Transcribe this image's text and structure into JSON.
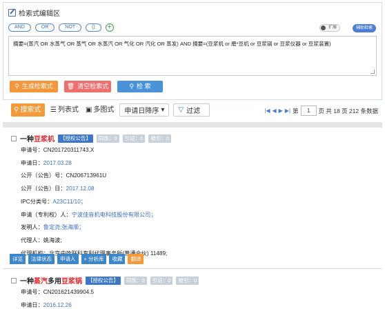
{
  "editor": {
    "title": "检索式编辑区",
    "ops": [
      "AND",
      "OR",
      "NOT",
      "()"
    ],
    "toggle_label": "扩展",
    "help_label": "辅助检索",
    "query": "摘要=(蒸汽 OR 水蒸气 OR 蒸气 OR 水蒸汽 OR 气化 OR 汽化 OR 蒸发) AND 摘要=(豆浆机 or 磨*豆机 or 豆浆锅 or 豆浆仪器 or 豆浆装置)",
    "btn_generate": "生成检索式",
    "btn_clear": "清空检索式",
    "btn_search": "检 索"
  },
  "toolbar": {
    "tab_search": "搜索式",
    "tab_list": "列表式",
    "tab_multi": "多图式",
    "sort": "申请日降序",
    "filter": "过滤"
  },
  "pager": {
    "prefix": "第",
    "page": "1",
    "suffix": "页 共 18 页 212 条数据"
  },
  "records": [
    {
      "title_pre": "一种",
      "title_hl": "豆浆机",
      "title_mid": "",
      "title_hl2": "",
      "tag": "【授权公告】",
      "same_family": "同族：0",
      "cited": "引证：0",
      "cited_by": "被引：0",
      "app_no": "申请号：CN201720311743.X",
      "app_date_label": "申请日：",
      "app_date": "2017.03.28",
      "pub_no": "公开（公告）号：CN206713961U",
      "pub_date_label": "公开（公告）日：",
      "pub_date": "2017.12.08",
      "ipc_label": "IPC分类号：",
      "ipc": "A23C11/10；",
      "applicant_label": "申请（专利权）人：",
      "applicant": "宁波佳音机电科技股份有限公司；",
      "inventor_label": "发明人：",
      "inventor": "鲁定尧;张海顺；",
      "agent": "代理人：姚海波;",
      "agency": "代理机构：北京中政联科专利代理事务所(普通合伙) 11489;"
    },
    {
      "title_pre": "一种",
      "title_hl": "蒸汽",
      "title_mid": "多用",
      "title_hl2": "豆浆锅",
      "tag": "【授权公告】",
      "same_family": "同族：0",
      "cited": "引证：0",
      "cited_by": "被引：0",
      "app_no": "申请号：CN201621439904.5",
      "app_date_label": "申请日：",
      "app_date": "2016.12.26"
    }
  ],
  "actions": [
    "详览",
    "法律状态",
    "申请人",
    "+ 分析库",
    "收藏",
    "翻译"
  ]
}
